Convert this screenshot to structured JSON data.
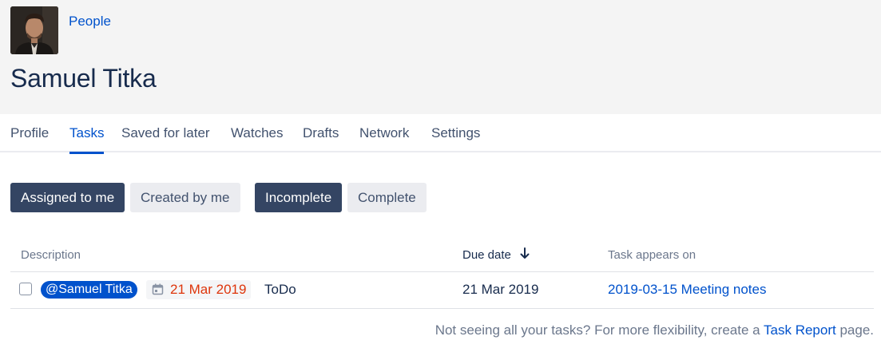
{
  "header": {
    "breadcrumb": "People",
    "title": "Samuel Titka"
  },
  "tabs": [
    {
      "label": "Profile",
      "active": false
    },
    {
      "label": "Tasks",
      "active": true
    },
    {
      "label": "Saved for later",
      "active": false
    },
    {
      "label": "Watches",
      "active": false
    },
    {
      "label": "Drafts",
      "active": false
    },
    {
      "label": "Network",
      "active": false
    },
    {
      "label": "Settings",
      "active": false
    }
  ],
  "filters": {
    "owner": [
      {
        "label": "Assigned to me",
        "selected": true
      },
      {
        "label": "Created by me",
        "selected": false
      }
    ],
    "status": [
      {
        "label": "Incomplete",
        "selected": true
      },
      {
        "label": "Complete",
        "selected": false
      }
    ]
  },
  "table": {
    "columns": {
      "description": "Description",
      "due_date": "Due date",
      "appears_on": "Task appears on"
    },
    "sort": {
      "column": "due_date",
      "direction": "descending",
      "icon": "arrow-down-icon"
    },
    "rows": [
      {
        "checked": false,
        "mention": "@Samuel Titka",
        "date": "21 Mar 2019",
        "text": "ToDo",
        "due_date": "21 Mar 2019",
        "page": "2019-03-15 Meeting notes"
      }
    ]
  },
  "footer": {
    "text": "Not seeing all your tasks? For more flexibility, create a",
    "link": "Task Report",
    "suffix": "page."
  },
  "colors": {
    "link": "#0052cc",
    "selected_button": "#344563",
    "overdue_date": "#de350b",
    "header_bg": "#f4f4f4"
  }
}
